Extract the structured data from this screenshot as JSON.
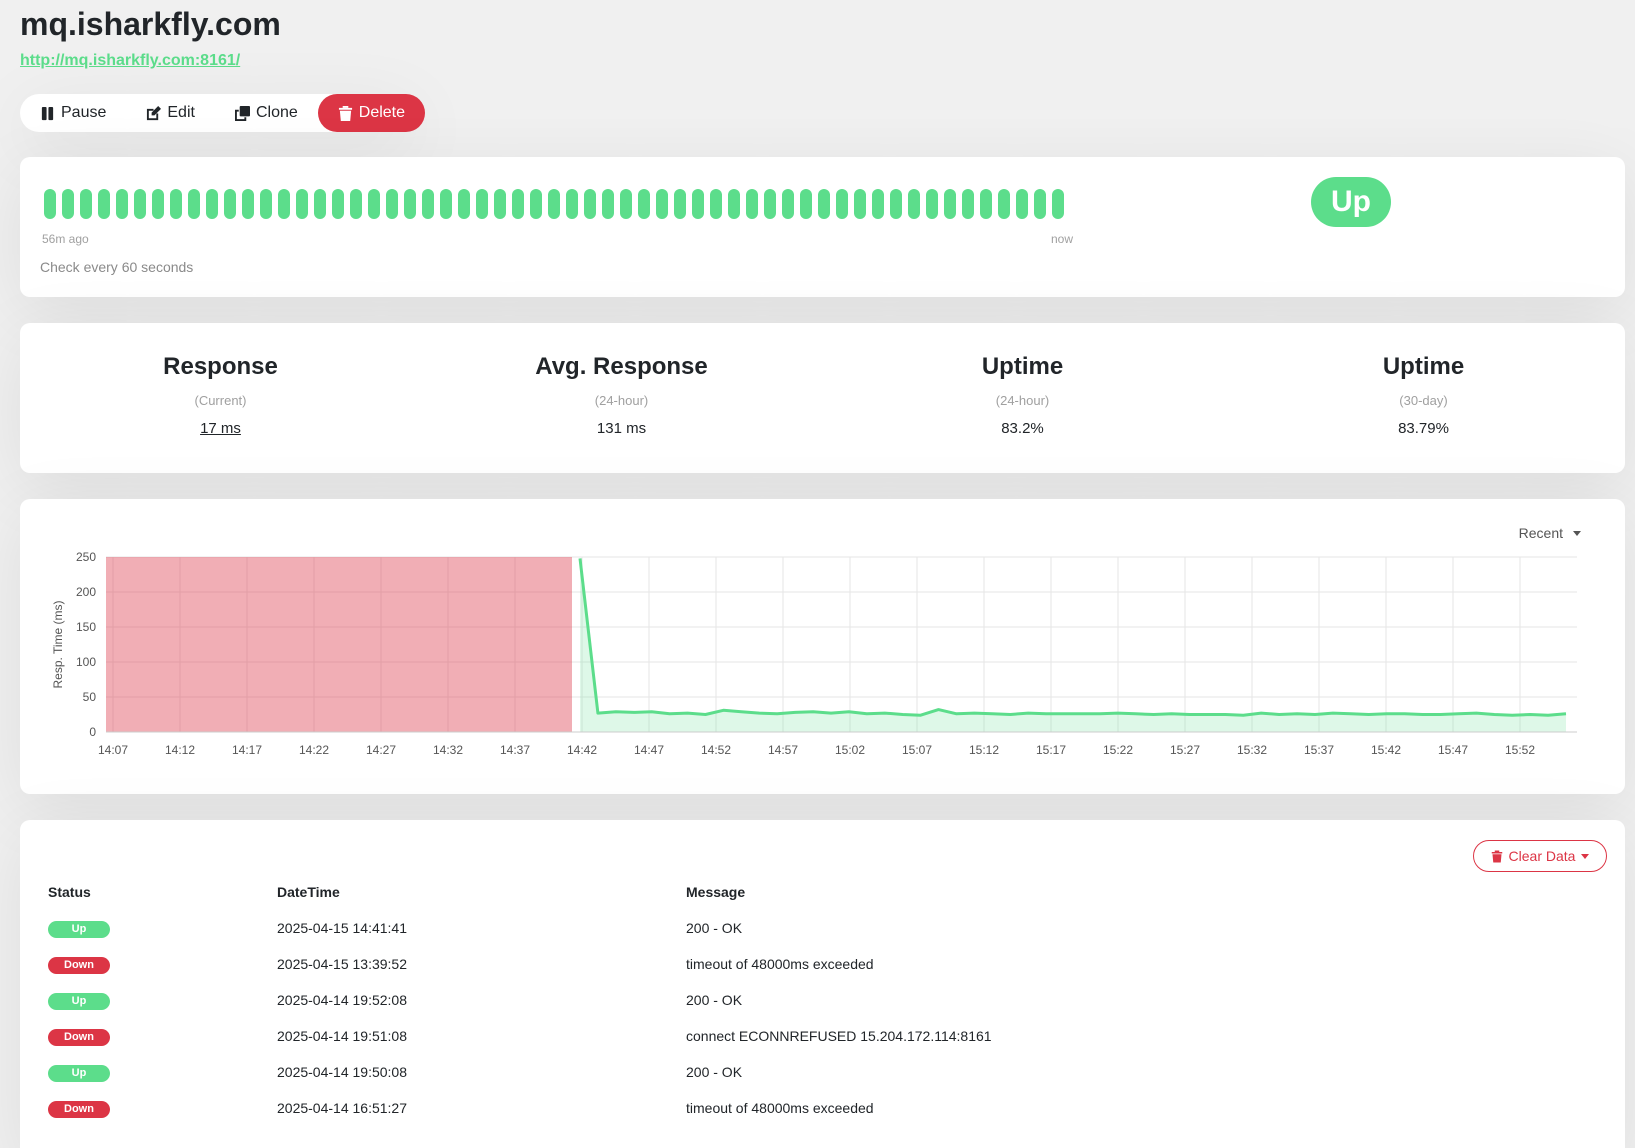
{
  "monitor": {
    "name": "mq.isharkfly.com",
    "url": "http://mq.isharkfly.com:8161/"
  },
  "actions": {
    "pause": "Pause",
    "edit": "Edit",
    "clone": "Clone",
    "delete": "Delete"
  },
  "heartbeat": {
    "beat_count": 57,
    "beat_color": "#5cdd8b",
    "start_label": "56m ago",
    "end_label": "now",
    "interval_text": "Check every 60 seconds",
    "status": "Up"
  },
  "stats": [
    {
      "title": "Response",
      "sub": "(Current)",
      "value": "17 ms"
    },
    {
      "title": "Avg. Response",
      "sub": "(24-hour)",
      "value": "131 ms"
    },
    {
      "title": "Uptime",
      "sub": "(24-hour)",
      "value": "83.2%"
    },
    {
      "title": "Uptime",
      "sub": "(30-day)",
      "value": "83.79%"
    }
  ],
  "chart_range": "Recent",
  "chart_data": {
    "type": "line",
    "ylabel": "Resp. Time (ms)",
    "xlabel": "",
    "ylim": [
      0,
      250
    ],
    "yticks": [
      0,
      50,
      100,
      150,
      200,
      250
    ],
    "xticks": [
      "14:07",
      "14:12",
      "14:17",
      "14:22",
      "14:27",
      "14:32",
      "14:37",
      "14:42",
      "14:47",
      "14:52",
      "14:57",
      "15:02",
      "15:07",
      "15:12",
      "15:17",
      "15:22",
      "15:27",
      "15:32",
      "15:37",
      "15:42",
      "15:47",
      "15:52"
    ],
    "x_minutes": [
      0,
      55
    ],
    "down_region": {
      "from_minute": 0,
      "to_minute": 34.8,
      "color": "#dc3545"
    },
    "line_color": "#5cdd8b",
    "series": [
      {
        "minutes": [
          35.0,
          35.5,
          36,
          37,
          38,
          39,
          40,
          41,
          42,
          43,
          44,
          45,
          46,
          47,
          48,
          49,
          50,
          51,
          52,
          53,
          54,
          55,
          56,
          57,
          58,
          59,
          60,
          61,
          62,
          63,
          64,
          65,
          66,
          67,
          68,
          69,
          70,
          71,
          72,
          73,
          74,
          75,
          76,
          77,
          78,
          79,
          80,
          81,
          82,
          83,
          84,
          85,
          86,
          87,
          88,
          89
        ],
        "values": [
          248,
          27,
          29,
          28,
          29,
          26,
          27,
          25,
          31,
          29,
          27,
          26,
          28,
          29,
          27,
          29,
          26,
          27,
          25,
          24,
          32,
          26,
          27,
          26,
          25,
          27,
          26,
          26,
          26,
          26,
          27,
          26,
          25,
          26,
          25,
          25,
          25,
          24,
          27,
          25,
          26,
          25,
          27,
          26,
          25,
          26,
          26,
          25,
          25,
          26,
          27,
          25,
          24,
          25,
          24,
          26
        ]
      }
    ]
  },
  "events": {
    "clear_label": "Clear Data",
    "headers": {
      "status": "Status",
      "datetime": "DateTime",
      "message": "Message"
    },
    "rows": [
      {
        "status": "Up",
        "datetime": "2025-04-15 14:41:41",
        "message": "200 - OK"
      },
      {
        "status": "Down",
        "datetime": "2025-04-15 13:39:52",
        "message": "timeout of 48000ms exceeded"
      },
      {
        "status": "Up",
        "datetime": "2025-04-14 19:52:08",
        "message": "200 - OK"
      },
      {
        "status": "Down",
        "datetime": "2025-04-14 19:51:08",
        "message": "connect ECONNREFUSED 15.204.172.114:8161"
      },
      {
        "status": "Up",
        "datetime": "2025-04-14 19:50:08",
        "message": "200 - OK"
      },
      {
        "status": "Down",
        "datetime": "2025-04-14 16:51:27",
        "message": "timeout of 48000ms exceeded"
      }
    ]
  }
}
